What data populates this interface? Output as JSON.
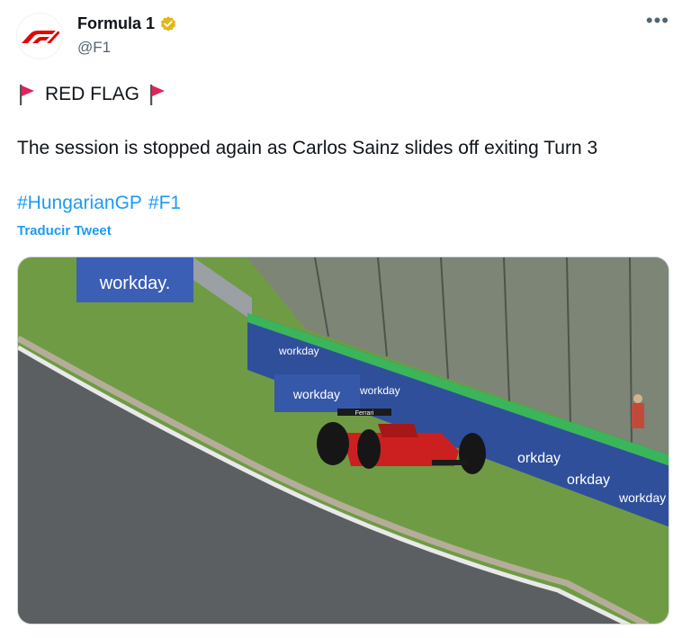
{
  "author": {
    "name": "Formula 1",
    "handle": "@F1",
    "avatar_icon": "f1-logo-icon",
    "verified_icon": "verified-gold-badge-icon"
  },
  "menu_icon": "more-options-icon",
  "tweet": {
    "headline": "RED FLAG",
    "headline_icons": [
      "red-flag-icon",
      "red-flag-icon"
    ],
    "body": "The session is stopped again as Carlos Sainz slides off exiting Turn 3",
    "hashtags": [
      "#HungarianGP",
      "#F1"
    ],
    "translate_label": "Traducir Tweet"
  },
  "media": {
    "banner_text": "workday.",
    "barrier_texts": [
      "workday",
      "workday",
      "workday",
      "orkday",
      "orkday",
      "workday"
    ],
    "car_text": "Ferrari"
  },
  "colors": {
    "link": "#1d9bf0",
    "brand_red": "#e10600",
    "verified_gold": "#e2b719",
    "secondary_text": "#536471"
  }
}
